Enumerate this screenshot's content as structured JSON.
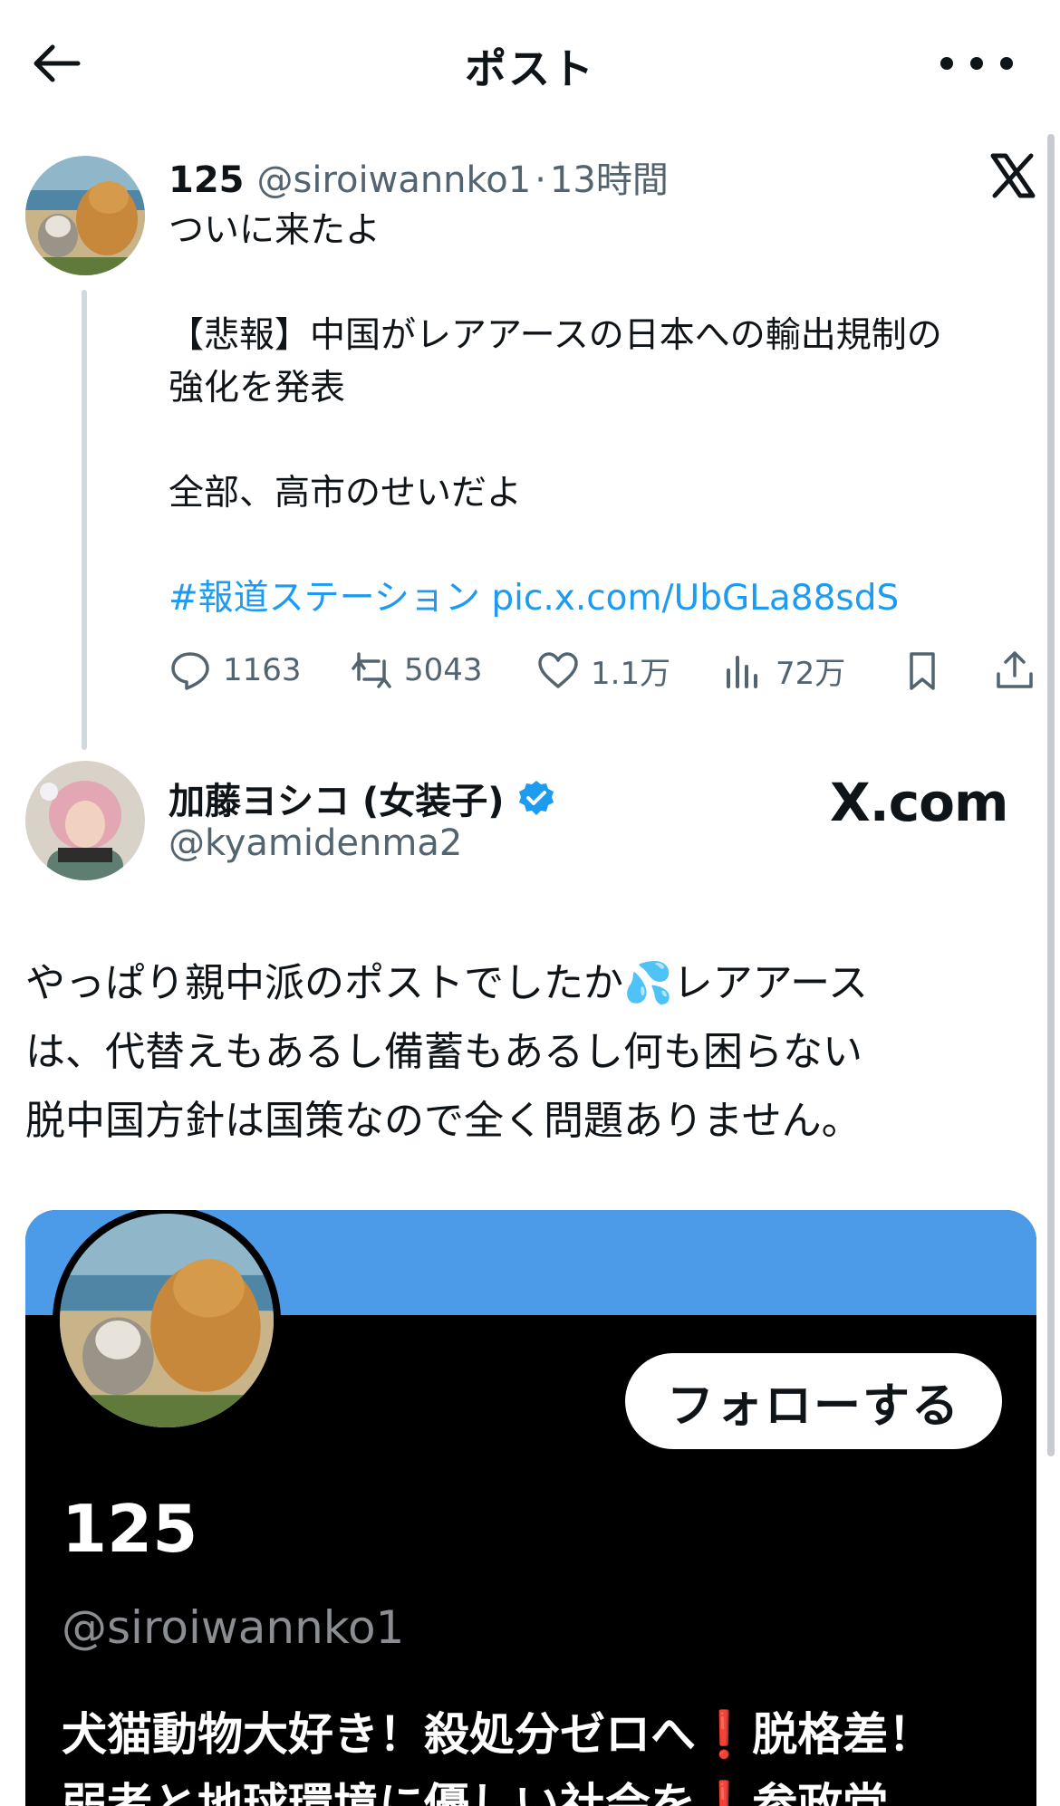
{
  "header": {
    "title": "ポスト"
  },
  "parent_post": {
    "author_name": "125",
    "handle": "@siroiwannko1",
    "separator": "·",
    "time": "13時間",
    "lines": [
      "ついに来たよ",
      "",
      "【悲報】中国がレアアースの日本への輸出規制の",
      "強化を発表",
      "",
      "全部、高市のせいだよ",
      ""
    ],
    "hashtag": "#報道ステーション",
    "pic_link": "pic.x.com/UbGLa88sdS",
    "stats": {
      "replies": "1163",
      "reposts": "5043",
      "likes": "1.1万",
      "views": "72万"
    }
  },
  "quote_post": {
    "author_name": "加藤ヨシコ (女装子)",
    "handle": "@kyamidenma2",
    "source_label": "X.com",
    "body_lines": [
      "やっぱり親中派のポストでしたか💦レアアース",
      "は、代替えもあるし備蓄もあるし何も困らない",
      "脱中国方針は国策なので全く問題ありません。"
    ]
  },
  "profile_card": {
    "follow_label": "フォローする",
    "name": "125",
    "handle": "@siroiwannko1",
    "bio_line1_a": "犬猫動物大好き！殺処分ゼロへ",
    "bio_line1_mark": "❗",
    "bio_line1_b": "脱格差！",
    "bio_line2_a": "弱者と地球環境に優しい社会を",
    "bio_line2_mark": "❗",
    "bio_line2_b": "参政党、",
    "banner_color": "#4c9be8"
  },
  "colors": {
    "accent_link": "#1d9bf0",
    "secondary_text": "#536471",
    "verified_badge": "#1d9bf0"
  }
}
